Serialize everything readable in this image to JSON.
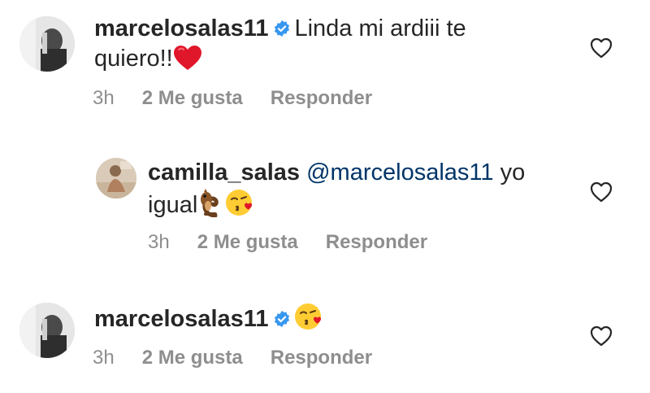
{
  "comments": [
    {
      "username": "marcelosalas11",
      "verified": true,
      "text_line1": "Linda mi ardiii te",
      "text_line2": "quiero!!",
      "emoji": "red-heart",
      "time": "3h",
      "likes": "2 Me gusta",
      "reply": "Responder"
    },
    {
      "username": "camilla_salas",
      "verified": false,
      "mention": "@marcelosalas11",
      "text_line1": "yo",
      "text_line2": "igual",
      "emoji": "chipmunk, face-blowing-a-kiss",
      "time": "3h",
      "likes": "2 Me gusta",
      "reply": "Responder"
    },
    {
      "username": "marcelosalas11",
      "verified": true,
      "emoji": "face-blowing-a-kiss",
      "time": "3h",
      "likes": "2 Me gusta",
      "reply": "Responder"
    }
  ],
  "colors": {
    "text": "#262626",
    "meta": "#8e8e8e",
    "mention": "#003569",
    "verified": "#3897f0"
  }
}
